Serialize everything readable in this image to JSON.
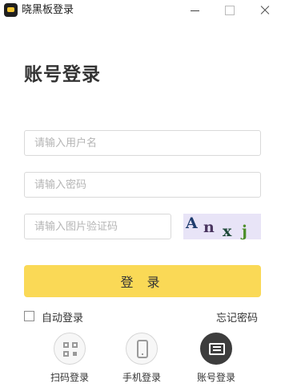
{
  "window": {
    "title": "晓黑板登录",
    "icons": {
      "logo": "app-logo",
      "minimize": "minimize-icon",
      "maximize": "maximize-icon",
      "close": "close-icon"
    }
  },
  "page": {
    "title": "账号登录"
  },
  "form": {
    "username_placeholder": "请输入用户名",
    "password_placeholder": "请输入密码",
    "captcha_placeholder": "请输入图片验证码",
    "captcha_chars": [
      "A",
      "n",
      "x",
      "j"
    ],
    "submit_label": "登 录",
    "auto_login_label": "自动登录",
    "auto_login_checked": false,
    "forgot_label": "忘记密码"
  },
  "login_methods": [
    {
      "label": "扫码登录",
      "icon": "qrcode-icon",
      "active": false
    },
    {
      "label": "手机登录",
      "icon": "phone-icon",
      "active": false
    },
    {
      "label": "账号登录",
      "icon": "account-icon",
      "active": true
    }
  ],
  "colors": {
    "accent": "#fad956",
    "active_method": "#3d3d3d",
    "captcha_bg": "#e8e4f7"
  }
}
